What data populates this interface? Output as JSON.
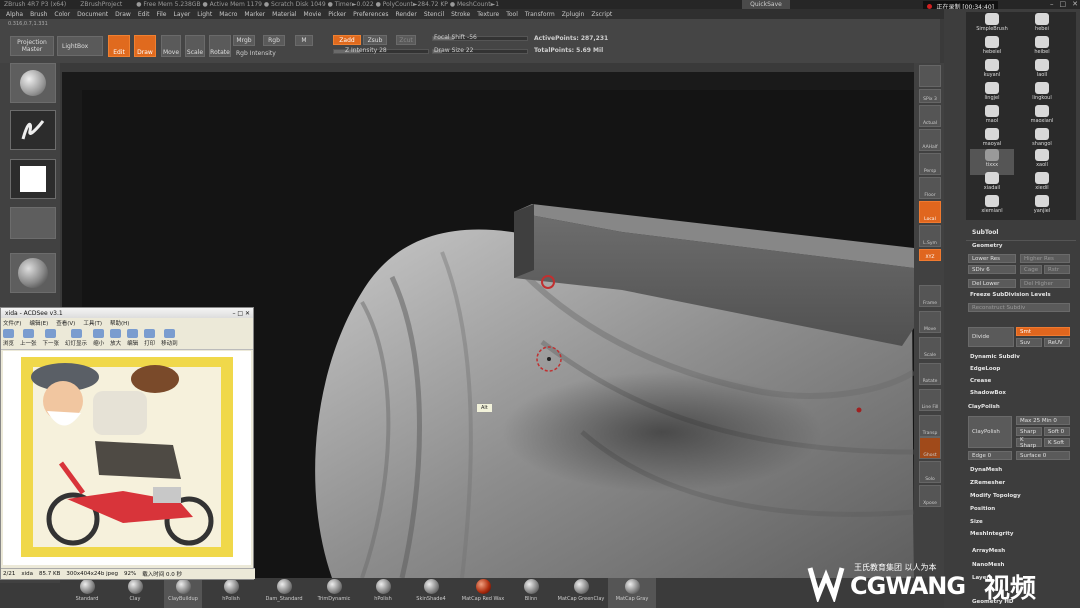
{
  "titlebar": {
    "segments": [
      "ZBrush 4R7 P3 (x64)",
      "ZBrushProject",
      "● Free Mem 5.238GB ● Active Mem 1179 ● Scratch Disk 1049 ● Timer►0.022 ● PolyCount►284.72 KP ● MeshCount►1"
    ],
    "quicksave": "QuickSave",
    "recording": "正在录制 [00:34:40]"
  },
  "menu": [
    "Alpha",
    "Brush",
    "Color",
    "Document",
    "Draw",
    "Edit",
    "File",
    "Layer",
    "Light",
    "Macro",
    "Marker",
    "Material",
    "Movie",
    "Picker",
    "Preferences",
    "Render",
    "Stencil",
    "Stroke",
    "Texture",
    "Tool",
    "Transform",
    "Zplugin",
    "Zscript"
  ],
  "coords": "0.316,0.7,1.331",
  "shelf": {
    "projection_master": "Projection Master",
    "lightbox": "LightBox",
    "edit": "Edit",
    "draw": "Draw",
    "move": "Move",
    "scale": "Scale",
    "rotate": "Rotate",
    "mrgb": "Mrgb",
    "rgb": "Rgb",
    "m": "M",
    "zadd": "Zadd",
    "zsub": "Zsub",
    "zcut": "Zcut",
    "rgb_intensity": "Rgb Intensity",
    "z_intensity_label": "Z Intensity",
    "z_intensity": "28",
    "focal_shift_label": "Focal Shift",
    "focal_shift": "-56",
    "draw_size_label": "Draw Size",
    "draw_size": "22",
    "active_points": "ActivePoints: 287,231",
    "total_points": "TotalPoints: 5.69 Mil"
  },
  "right_tools": [
    "SPix 3",
    "Actual",
    "AAHalf",
    "Persp",
    "Floor",
    "Local",
    "L.Sym",
    "XYZ",
    "Frame",
    "Move",
    "Scale",
    "Rotate",
    "Line Fill",
    "Transp",
    "Ghost",
    "Solo",
    "Xpose"
  ],
  "brushes": [
    {
      "name": "SimpleBrush"
    },
    {
      "name": "hebei"
    },
    {
      "name": "hebeiel"
    },
    {
      "name": "heibel"
    },
    {
      "name": "kuyanl"
    },
    {
      "name": "laoll"
    },
    {
      "name": "lingjel"
    },
    {
      "name": "lingkoul"
    },
    {
      "name": "maol"
    },
    {
      "name": "maoxianl"
    },
    {
      "name": "maoyal"
    },
    {
      "name": "shangol"
    },
    {
      "name": "tixxx"
    },
    {
      "name": "xaoll"
    },
    {
      "name": "xiadail"
    },
    {
      "name": "xiedil"
    },
    {
      "name": "xiemianl"
    },
    {
      "name": "yanjiel"
    }
  ],
  "subtool": "SubTool",
  "geometry": {
    "header": "Geometry",
    "lower_res": "Lower Res",
    "higher_res": "Higher Res",
    "sdiv": "SDiv 6",
    "cage": "Cage",
    "rstr": "Rstr",
    "del_lower": "Del Lower",
    "del_higher": "Del Higher",
    "freeze": "Freeze SubDivision Levels",
    "reconstruct": "Reconstruct Subdiv",
    "divide": "Divide",
    "smt": "Smt",
    "suv": "Suv",
    "reuv": "ReUV",
    "items": [
      "Dynamic Subdiv",
      "EdgeLoop",
      "Crease",
      "ShadowBox"
    ],
    "claypolish_header": "ClayPolish",
    "claypolish_btn": "ClayPolish",
    "max": "Max 25",
    "min": "Min 0",
    "sharp": "Sharp",
    "soft": "Soft 0",
    "kedge": "K Sharp",
    "ksoft": "K Soft",
    "edge": "Edge 0",
    "surface": "Surface 0",
    "items2": [
      "DynaMesh",
      "ZRemesher",
      "Modify Topology",
      "Position",
      "Size",
      "MeshIntegrity"
    ],
    "arraymesh": "ArrayMesh",
    "nanomesh": "NanoMesh",
    "layers": "Layers",
    "geometry_hd": "Geometry HD"
  },
  "canvas": {
    "alt_label": "Alt"
  },
  "materials": [
    {
      "name": "Standard"
    },
    {
      "name": "Clay"
    },
    {
      "name": "ClayBuildup"
    },
    {
      "name": "hPolish"
    },
    {
      "name": "Dam_Standard"
    },
    {
      "name": "TrimDynamic"
    },
    {
      "name": "hPolish"
    },
    {
      "name": "SkinShade4"
    },
    {
      "name": "MatCap Red Wax"
    },
    {
      "name": "Blinn"
    },
    {
      "name": "MatCap GreenClay"
    },
    {
      "name": "MatCap Gray"
    }
  ],
  "acdsee": {
    "title": "xida - ACDSee v3.1",
    "menu": [
      "文件(F)",
      "编辑(E)",
      "查看(V)",
      "工具(T)",
      "帮助(H)"
    ],
    "tools": [
      "浏览",
      "上一张",
      "下一张",
      "幻灯显示",
      "缩小",
      "放大",
      "编辑",
      "打印",
      "移动到"
    ],
    "status": [
      "2/21",
      "xida",
      "85.7 KB",
      "300x404x24b jpeg",
      "92%",
      "载入时间 0.0 秒"
    ]
  },
  "watermark": {
    "brand": "CGWANG",
    "cn": "视频",
    "slogan": "王氏教育集团 以人为本"
  }
}
